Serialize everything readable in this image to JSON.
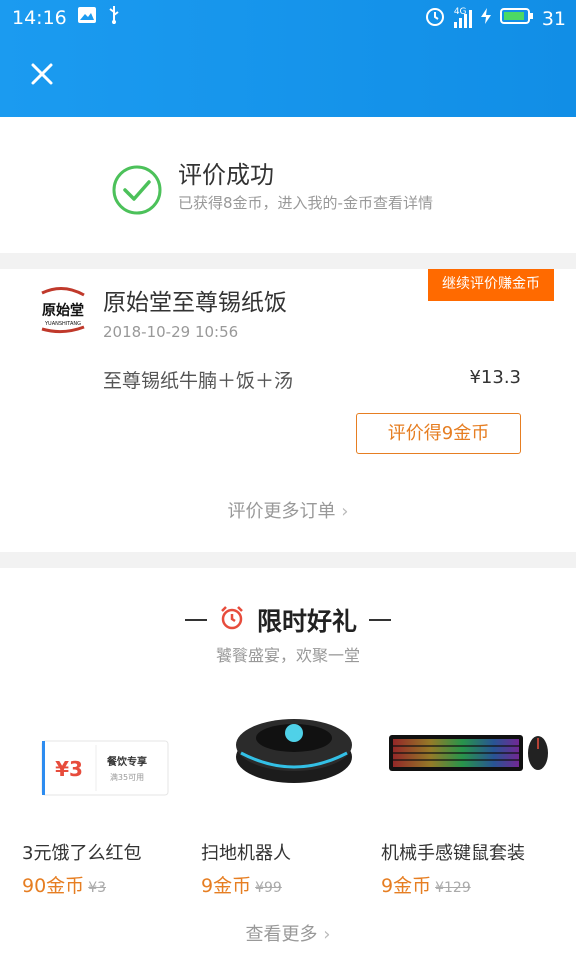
{
  "status_bar": {
    "time": "14:16",
    "battery_level": "31",
    "network_label": "4G"
  },
  "header": {
    "close_icon": "close-icon"
  },
  "success": {
    "title": "评价成功",
    "subtitle": "已获得8金币，进入我的-金币查看详情"
  },
  "order": {
    "promo_ribbon": "继续评价赚金币",
    "shop_name": "原始堂至尊锡纸饭",
    "logo_text": "原始堂",
    "logo_subtext": "YUANSHITANG",
    "time": "2018-10-29 10:56",
    "item_name": "至尊锡纸牛腩＋饭＋汤",
    "item_price": "¥13.3",
    "review_button": "评价得9金币",
    "more_orders": "评价更多订单"
  },
  "gifts": {
    "title": "限时好礼",
    "subtitle": "饕餮盛宴，欢聚一堂",
    "coupon_amount": "¥3",
    "coupon_label": "餐饮专享",
    "coupon_condition": "满35可用",
    "items": [
      {
        "name": "3元饿了么红包",
        "coin": "90金币",
        "orig": "¥3"
      },
      {
        "name": "扫地机器人",
        "coin": "9金币",
        "orig": "¥99"
      },
      {
        "name": "机械手感键鼠套装",
        "coin": "9金币",
        "orig": "¥129"
      }
    ],
    "see_more": "查看更多"
  },
  "colors": {
    "header_blue": "#1b9bf0",
    "accent_orange": "#e67e22",
    "success_green": "#4cc15a"
  }
}
